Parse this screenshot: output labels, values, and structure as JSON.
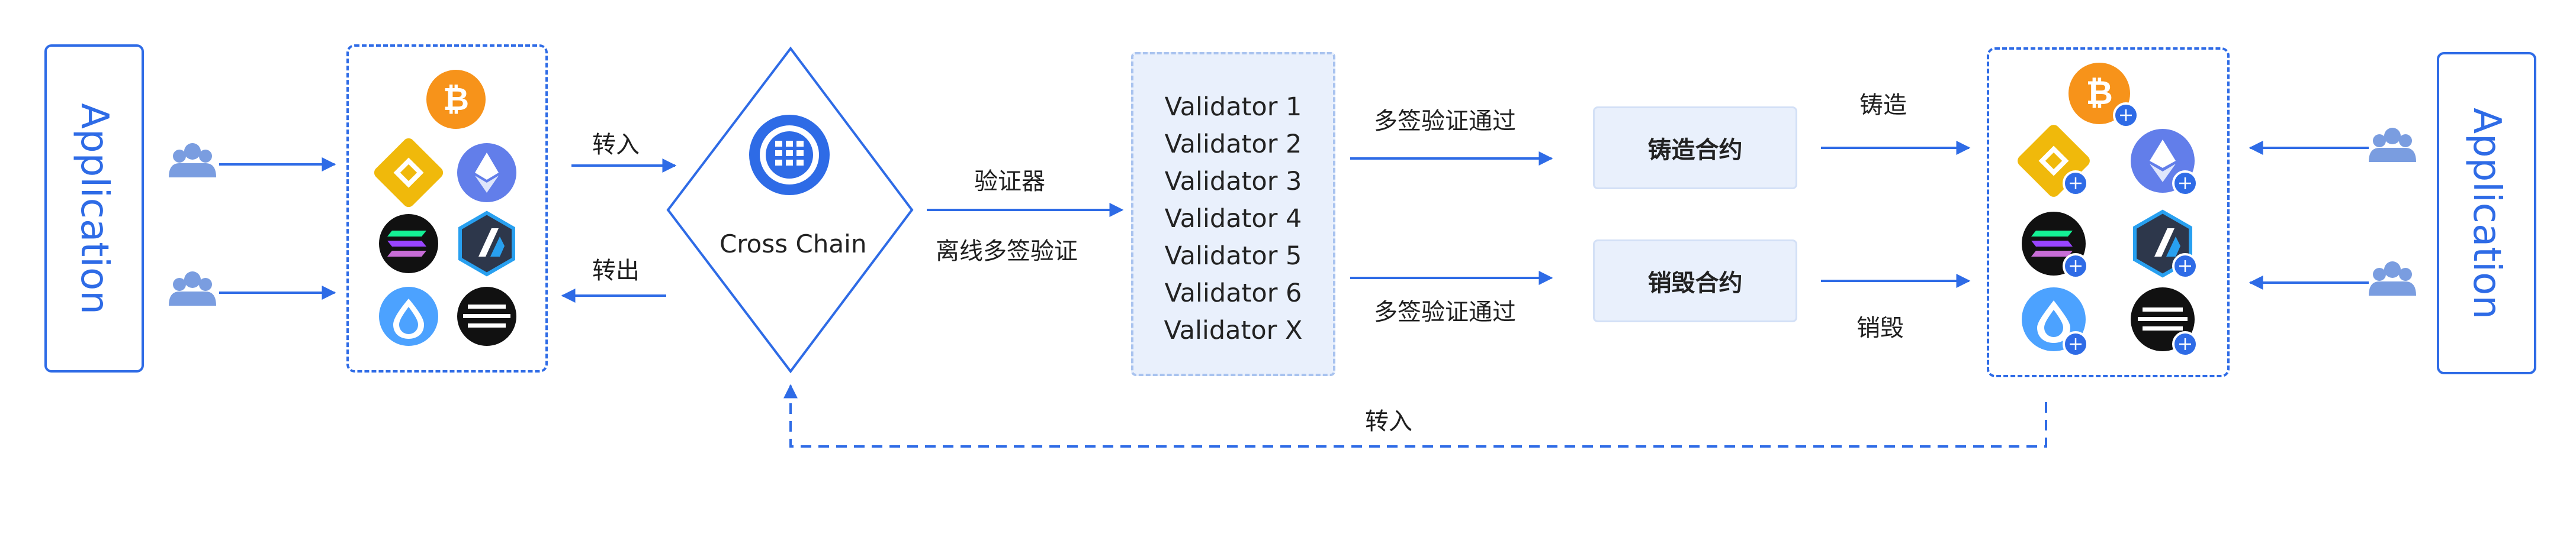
{
  "left_app": {
    "label": "Application"
  },
  "right_app": {
    "label": "Application"
  },
  "cross_chain": {
    "label": "Cross Chain"
  },
  "arrows": {
    "transfer_in": "转入",
    "transfer_out": "转出",
    "validator": "验证器",
    "offline_multisig": "离线多签验证",
    "multisig_pass_top": "多签验证通过",
    "multisig_pass_bottom": "多签验证通过",
    "mint": "铸造",
    "burn": "销毁",
    "return_transfer_in": "转入"
  },
  "validators": [
    "Validator 1",
    "Validator 2",
    "Validator 3",
    "Validator 4",
    "Validator 5",
    "Validator 6",
    "Validator X"
  ],
  "contracts": {
    "mint": "铸造合约",
    "burn": "销毁合约"
  },
  "coins": [
    "bitcoin-icon",
    "bnb-icon",
    "ethereum-icon",
    "solana-icon",
    "arbitrum-icon",
    "sui-icon",
    "aptos-icon"
  ],
  "colors": {
    "accent": "#2e6be6",
    "validator_bg": "#e9f0fc",
    "bitcoin": "#f7931a",
    "bnb": "#f0b90b",
    "ethereum": "#627eea",
    "sui": "#4ca2ff"
  }
}
